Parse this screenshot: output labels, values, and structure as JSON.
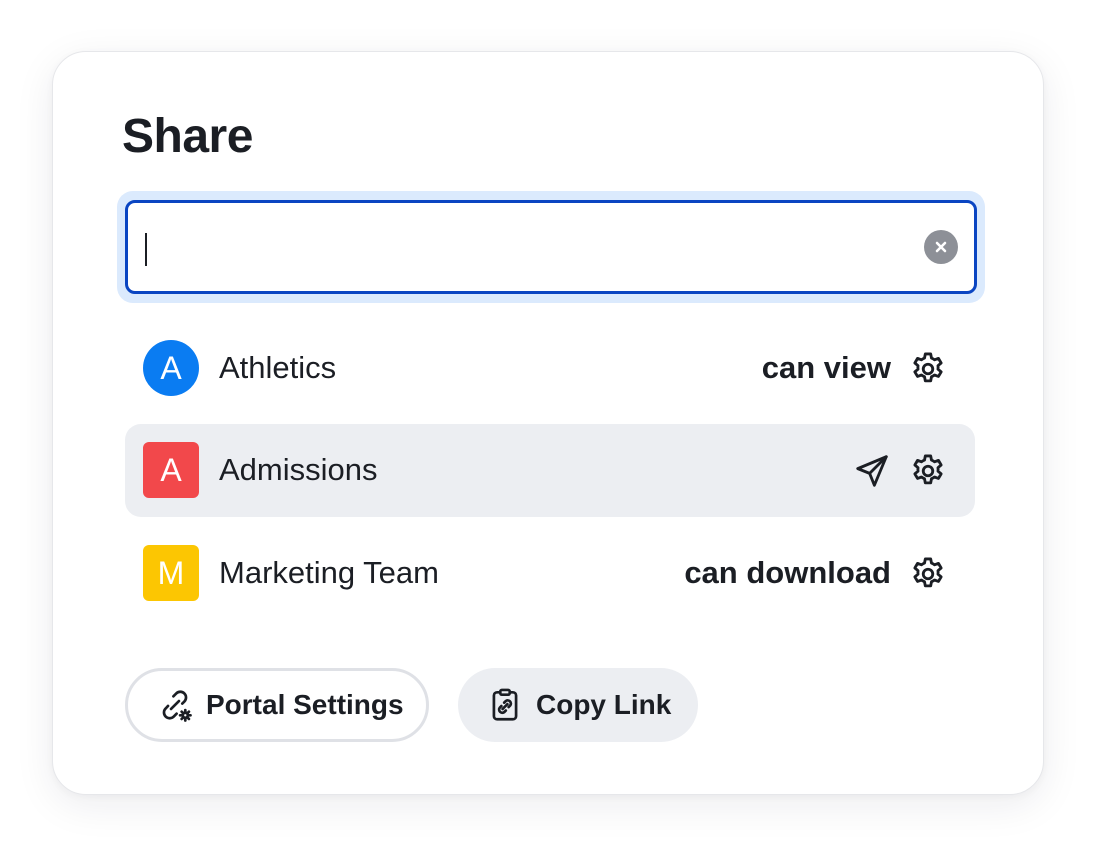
{
  "dialog": {
    "title": "Share"
  },
  "search": {
    "value": "",
    "placeholder": ""
  },
  "members": [
    {
      "initial": "A",
      "name": "Athletics",
      "permission": "can view",
      "avatar_color": "#0a7cf2",
      "avatar_shape": "circle"
    },
    {
      "initial": "A",
      "name": "Admissions",
      "permission": "",
      "avatar_color": "#f2484b",
      "avatar_shape": "square"
    },
    {
      "initial": "M",
      "name": "Marketing Team",
      "permission": "can download",
      "avatar_color": "#fcc602",
      "avatar_shape": "square"
    }
  ],
  "actions": {
    "portal_settings_label": "Portal Settings",
    "copy_link_label": "Copy Link"
  },
  "colors": {
    "focus_border": "#0a45c2",
    "focus_ring": "#dbeafd",
    "row_highlight": "#eceef2",
    "text": "#1b1e24"
  },
  "icons": [
    "clear-icon",
    "gear-icon",
    "send-icon",
    "link-gear-icon",
    "clipboard-link-icon"
  ]
}
